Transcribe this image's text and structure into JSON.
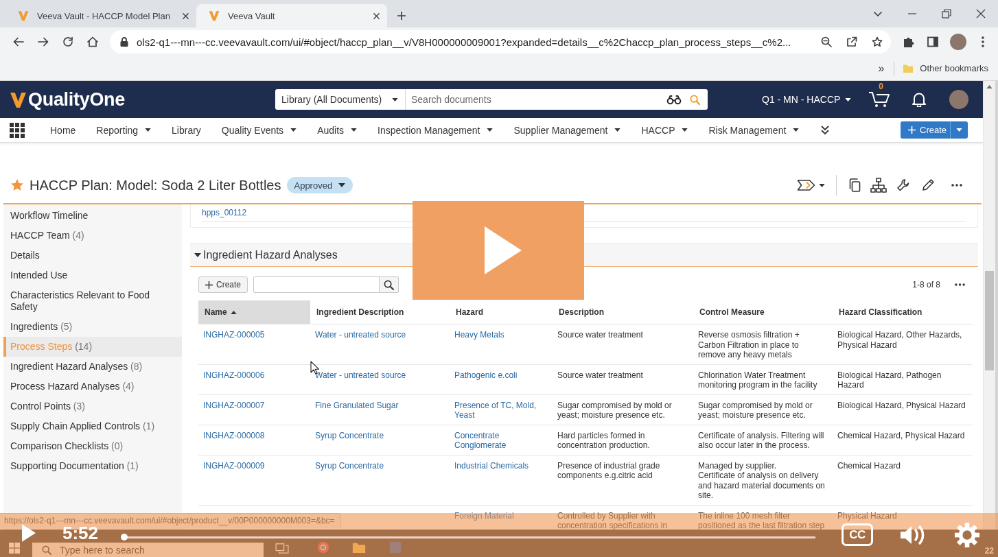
{
  "browser": {
    "tabs": [
      {
        "title": "Veeva Vault - HACCP Model Plan",
        "selected": false
      },
      {
        "title": "Veeva Vault",
        "selected": true
      }
    ],
    "url": "ols2-q1---mn---cc.veevavault.com/ui/#object/haccp_plan__v/V8H000000009001?expanded=details__c%2Chaccp_plan_process_steps__c%2...",
    "bookmarks_overflow": "»",
    "bookmarks": [
      "Other bookmarks"
    ],
    "status_url": "https://ols2-q1---mn---cc.veevavault.com/ui/#object/product__v/00P000000000M003=&bc="
  },
  "app": {
    "name": "QualityOne",
    "search": {
      "scope": "Library (All Documents)",
      "placeholder": "Search documents"
    },
    "vault": "Q1 - MN - HACCP",
    "cart_count": "0",
    "nav": [
      {
        "label": "Home",
        "menu": false
      },
      {
        "label": "Reporting",
        "menu": true
      },
      {
        "label": "Library",
        "menu": false
      },
      {
        "label": "Quality Events",
        "menu": true
      },
      {
        "label": "Audits",
        "menu": true
      },
      {
        "label": "Inspection Management",
        "menu": true
      },
      {
        "label": "Supplier Management",
        "menu": true
      },
      {
        "label": "HACCP",
        "menu": true
      },
      {
        "label": "Risk Management",
        "menu": true
      }
    ],
    "create": "Create"
  },
  "record": {
    "title": "HACCP Plan: Model: Soda 2 Liter Bottles",
    "favorite": true,
    "status": "Approved"
  },
  "sidebar": {
    "items": [
      {
        "label": "Workflow Timeline",
        "selected": false
      },
      {
        "label": "HACCP Team",
        "count": "(4)",
        "selected": false
      },
      {
        "label": "Details",
        "selected": false
      },
      {
        "label": "Intended Use",
        "selected": false
      },
      {
        "label": "Characteristics Relevant to Food Safety",
        "selected": false
      },
      {
        "label": "Ingredients",
        "count": "(5)",
        "selected": false
      },
      {
        "label": "Process Steps",
        "count": "(14)",
        "selected": true
      },
      {
        "label": "Ingredient Hazard Analyses",
        "count": "(8)",
        "selected": false
      },
      {
        "label": "Process Hazard Analyses",
        "count": "(4)",
        "selected": false
      },
      {
        "label": "Control Points",
        "count": "(3)",
        "selected": false
      },
      {
        "label": "Supply Chain Applied Controls",
        "count": "(1)",
        "selected": false
      },
      {
        "label": "Comparison Checklists",
        "count": "(0)",
        "selected": false
      },
      {
        "label": "Supporting Documentation",
        "count": "(1)",
        "selected": false
      }
    ]
  },
  "previous_section": {
    "cells": [
      "hpps_00112"
    ]
  },
  "section": {
    "title": "Ingredient Hazard Analyses",
    "expanded": true,
    "create": "Create",
    "range": "1-8 of 8",
    "columns": [
      {
        "label": "Name",
        "kind": "link",
        "sorted": true
      },
      {
        "label": "Ingredient Description",
        "kind": "link",
        "sorted": false
      },
      {
        "label": "Hazard",
        "kind": "link",
        "sorted": false
      },
      {
        "label": "Description",
        "kind": "text",
        "sorted": false
      },
      {
        "label": "Control Measure",
        "kind": "text",
        "sorted": false
      },
      {
        "label": "Hazard Classification",
        "kind": "text",
        "sorted": false
      }
    ],
    "rows": [
      {
        "name": "INGHAZ-000005",
        "ingredient": "Water - untreated source",
        "hazard": "Heavy Metals",
        "description": "Source water treatment",
        "control_measure": "Reverse osmosis filtration + Carbon Filtration in place to remove any heavy metals",
        "classification": "Biological Hazard, Other Hazards, Physical Hazard"
      },
      {
        "name": "INGHAZ-000006",
        "ingredient": "Water - untreated source",
        "hazard": "Pathogenic e.coli",
        "description": "Source water treatment",
        "control_measure": "Chlorination Water Treatment monitoring program in the facility",
        "classification": "Biological Hazard, Pathogen Hazard"
      },
      {
        "name": "INGHAZ-000007",
        "ingredient": "Fine Granulated Sugar",
        "hazard": "Presence of TC, Mold, Yeast",
        "description": "Sugar compromised by mold or yeast; moisture presence etc.",
        "control_measure": "Sugar compromised by mold or yeast; moisture presence etc.",
        "classification": "Biological Hazard, Physical Hazard"
      },
      {
        "name": "INGHAZ-000008",
        "ingredient": "Syrup Concentrate",
        "hazard": "Concentrate Conglomerate",
        "description": "Hard particles formed in concentration production.",
        "control_measure": "Certificate of analysis. Filtering will also occur later in the process.",
        "classification": "Chemical Hazard, Physical Hazard"
      },
      {
        "name": "INGHAZ-000009",
        "ingredient": "Syrup Concentrate",
        "hazard": "Industrial Chemicals",
        "description": "Presence of industrial grade components e.g.citric acid",
        "control_measure": "Managed by supplier.\nCertificate of analysis on delivery and hazard material documents on site.",
        "classification": "Chemical Hazard"
      },
      {
        "hazard": "Foreign Material",
        "description": "Controlled by Supplier with concentration specifications in",
        "control_measure": "The inline 100 mesh filter positioned as the last filtration step",
        "classification": "Physical Hazard"
      }
    ]
  },
  "video": {
    "time": "5:52",
    "level": 0,
    "captions": "CC"
  },
  "taskbar": {
    "search_placeholder": "Type here to search",
    "date": "22"
  }
}
